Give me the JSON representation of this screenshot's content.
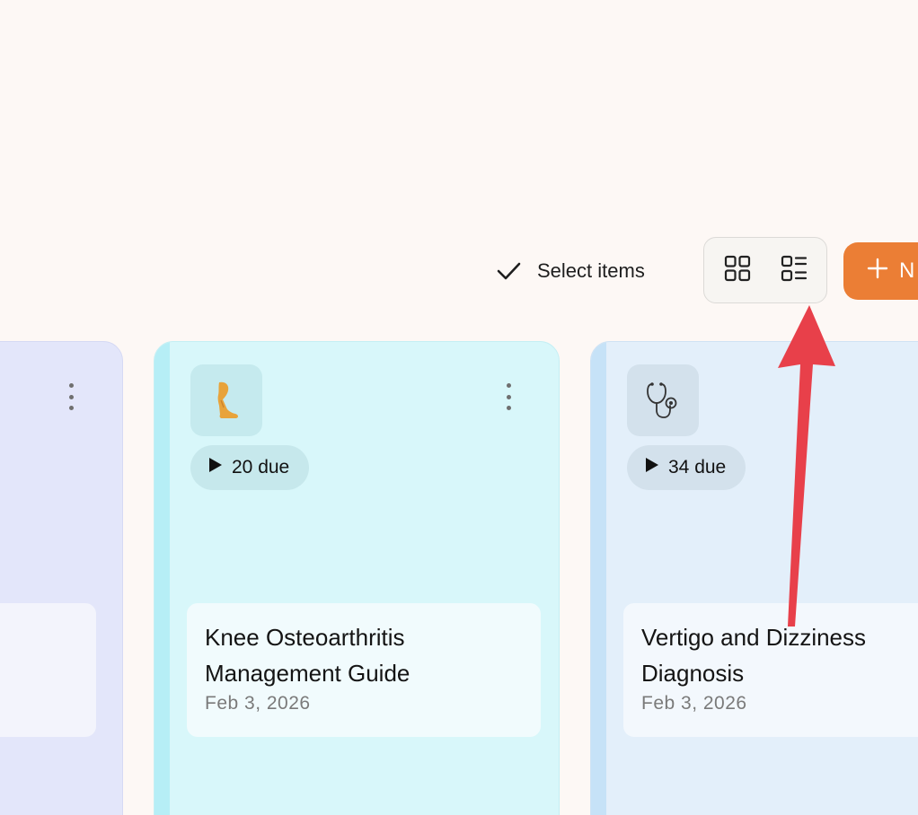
{
  "toolbar": {
    "select_items_label": "Select items",
    "view_modes": [
      "grid-view",
      "list-view"
    ],
    "new_button_label": "N"
  },
  "cards": [
    {
      "icon": "unknown",
      "due_label": "",
      "title": "",
      "date": ""
    },
    {
      "icon": "leg-emoji",
      "icon_glyph": "🦵",
      "due_label": "20 due",
      "title_line1": "Knee Osteoarthritis",
      "title_line2": "Management Guide",
      "date": "Feb 3, 2026",
      "color": "#d8f7fa"
    },
    {
      "icon": "stethoscope-icon",
      "due_label": "34 due",
      "title_line1": "Vertigo and Dizziness",
      "title_line2": "Diagnosis",
      "date": "Feb 3, 2026",
      "color": "#e3effa"
    }
  ],
  "colors": {
    "accent": "#eb7e35",
    "annotation_arrow": "#e8404a",
    "background": "#fdf8f5"
  }
}
